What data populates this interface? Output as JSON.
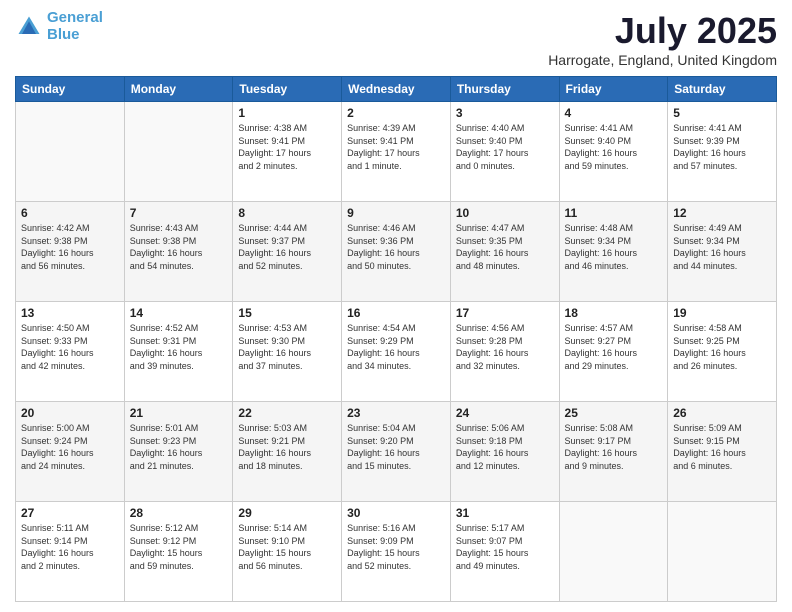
{
  "header": {
    "logo_line1": "General",
    "logo_line2": "Blue",
    "title": "July 2025",
    "subtitle": "Harrogate, England, United Kingdom"
  },
  "days_of_week": [
    "Sunday",
    "Monday",
    "Tuesday",
    "Wednesday",
    "Thursday",
    "Friday",
    "Saturday"
  ],
  "weeks": [
    [
      {
        "day": "",
        "info": ""
      },
      {
        "day": "",
        "info": ""
      },
      {
        "day": "1",
        "info": "Sunrise: 4:38 AM\nSunset: 9:41 PM\nDaylight: 17 hours\nand 2 minutes."
      },
      {
        "day": "2",
        "info": "Sunrise: 4:39 AM\nSunset: 9:41 PM\nDaylight: 17 hours\nand 1 minute."
      },
      {
        "day": "3",
        "info": "Sunrise: 4:40 AM\nSunset: 9:40 PM\nDaylight: 17 hours\nand 0 minutes."
      },
      {
        "day": "4",
        "info": "Sunrise: 4:41 AM\nSunset: 9:40 PM\nDaylight: 16 hours\nand 59 minutes."
      },
      {
        "day": "5",
        "info": "Sunrise: 4:41 AM\nSunset: 9:39 PM\nDaylight: 16 hours\nand 57 minutes."
      }
    ],
    [
      {
        "day": "6",
        "info": "Sunrise: 4:42 AM\nSunset: 9:38 PM\nDaylight: 16 hours\nand 56 minutes."
      },
      {
        "day": "7",
        "info": "Sunrise: 4:43 AM\nSunset: 9:38 PM\nDaylight: 16 hours\nand 54 minutes."
      },
      {
        "day": "8",
        "info": "Sunrise: 4:44 AM\nSunset: 9:37 PM\nDaylight: 16 hours\nand 52 minutes."
      },
      {
        "day": "9",
        "info": "Sunrise: 4:46 AM\nSunset: 9:36 PM\nDaylight: 16 hours\nand 50 minutes."
      },
      {
        "day": "10",
        "info": "Sunrise: 4:47 AM\nSunset: 9:35 PM\nDaylight: 16 hours\nand 48 minutes."
      },
      {
        "day": "11",
        "info": "Sunrise: 4:48 AM\nSunset: 9:34 PM\nDaylight: 16 hours\nand 46 minutes."
      },
      {
        "day": "12",
        "info": "Sunrise: 4:49 AM\nSunset: 9:34 PM\nDaylight: 16 hours\nand 44 minutes."
      }
    ],
    [
      {
        "day": "13",
        "info": "Sunrise: 4:50 AM\nSunset: 9:33 PM\nDaylight: 16 hours\nand 42 minutes."
      },
      {
        "day": "14",
        "info": "Sunrise: 4:52 AM\nSunset: 9:31 PM\nDaylight: 16 hours\nand 39 minutes."
      },
      {
        "day": "15",
        "info": "Sunrise: 4:53 AM\nSunset: 9:30 PM\nDaylight: 16 hours\nand 37 minutes."
      },
      {
        "day": "16",
        "info": "Sunrise: 4:54 AM\nSunset: 9:29 PM\nDaylight: 16 hours\nand 34 minutes."
      },
      {
        "day": "17",
        "info": "Sunrise: 4:56 AM\nSunset: 9:28 PM\nDaylight: 16 hours\nand 32 minutes."
      },
      {
        "day": "18",
        "info": "Sunrise: 4:57 AM\nSunset: 9:27 PM\nDaylight: 16 hours\nand 29 minutes."
      },
      {
        "day": "19",
        "info": "Sunrise: 4:58 AM\nSunset: 9:25 PM\nDaylight: 16 hours\nand 26 minutes."
      }
    ],
    [
      {
        "day": "20",
        "info": "Sunrise: 5:00 AM\nSunset: 9:24 PM\nDaylight: 16 hours\nand 24 minutes."
      },
      {
        "day": "21",
        "info": "Sunrise: 5:01 AM\nSunset: 9:23 PM\nDaylight: 16 hours\nand 21 minutes."
      },
      {
        "day": "22",
        "info": "Sunrise: 5:03 AM\nSunset: 9:21 PM\nDaylight: 16 hours\nand 18 minutes."
      },
      {
        "day": "23",
        "info": "Sunrise: 5:04 AM\nSunset: 9:20 PM\nDaylight: 16 hours\nand 15 minutes."
      },
      {
        "day": "24",
        "info": "Sunrise: 5:06 AM\nSunset: 9:18 PM\nDaylight: 16 hours\nand 12 minutes."
      },
      {
        "day": "25",
        "info": "Sunrise: 5:08 AM\nSunset: 9:17 PM\nDaylight: 16 hours\nand 9 minutes."
      },
      {
        "day": "26",
        "info": "Sunrise: 5:09 AM\nSunset: 9:15 PM\nDaylight: 16 hours\nand 6 minutes."
      }
    ],
    [
      {
        "day": "27",
        "info": "Sunrise: 5:11 AM\nSunset: 9:14 PM\nDaylight: 16 hours\nand 2 minutes."
      },
      {
        "day": "28",
        "info": "Sunrise: 5:12 AM\nSunset: 9:12 PM\nDaylight: 15 hours\nand 59 minutes."
      },
      {
        "day": "29",
        "info": "Sunrise: 5:14 AM\nSunset: 9:10 PM\nDaylight: 15 hours\nand 56 minutes."
      },
      {
        "day": "30",
        "info": "Sunrise: 5:16 AM\nSunset: 9:09 PM\nDaylight: 15 hours\nand 52 minutes."
      },
      {
        "day": "31",
        "info": "Sunrise: 5:17 AM\nSunset: 9:07 PM\nDaylight: 15 hours\nand 49 minutes."
      },
      {
        "day": "",
        "info": ""
      },
      {
        "day": "",
        "info": ""
      }
    ]
  ]
}
